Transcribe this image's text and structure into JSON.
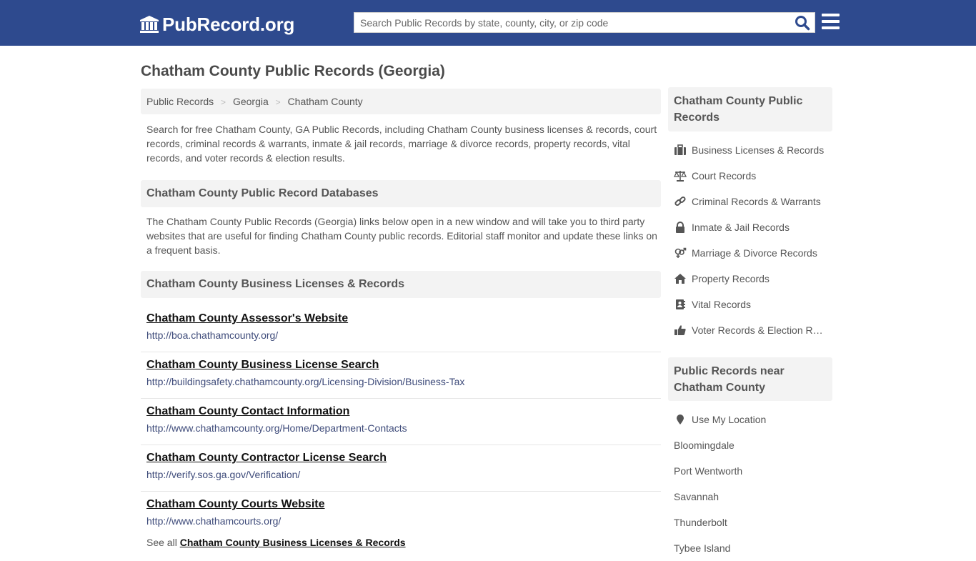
{
  "header": {
    "logo_text": "PubRecord.org",
    "search_placeholder": "Search Public Records by state, county, city, or zip code",
    "search_value": ""
  },
  "page": {
    "title": "Chatham County Public Records (Georgia)",
    "breadcrumb": [
      "Public Records",
      "Georgia",
      "Chatham County"
    ],
    "intro": "Search for free Chatham County, GA Public Records, including Chatham County business licenses & records, court records, criminal records & warrants, inmate & jail records, marriage & divorce records, property records, vital records, and voter records & election results."
  },
  "databases": {
    "heading": "Chatham County Public Record Databases",
    "description": "The Chatham County Public Records (Georgia) links below open in a new window and will take you to third party websites that are useful for finding Chatham County public records. Editorial staff monitor and update these links on a frequent basis."
  },
  "business": {
    "heading": "Chatham County Business Licenses & Records",
    "links": [
      {
        "title": "Chatham County Assessor's Website",
        "url": "http://boa.chathamcounty.org/"
      },
      {
        "title": "Chatham County Business License Search",
        "url": "http://buildingsafety.chathamcounty.org/Licensing-Division/Business-Tax"
      },
      {
        "title": "Chatham County Contact Information",
        "url": "http://www.chathamcounty.org/Home/Department-Contacts"
      },
      {
        "title": "Chatham County Contractor License Search",
        "url": "http://verify.sos.ga.gov/Verification/"
      },
      {
        "title": "Chatham County Courts Website",
        "url": "http://www.chathamcourts.org/"
      }
    ],
    "see_all_prefix": "See all",
    "see_all_link": "Chatham County Business Licenses & Records"
  },
  "sidebar": {
    "records_heading": "Chatham County Public Records",
    "records": [
      {
        "label": "Business Licenses & Records",
        "icon": "briefcase-icon"
      },
      {
        "label": "Court Records",
        "icon": "scale-icon"
      },
      {
        "label": "Criminal Records & Warrants",
        "icon": "link-icon"
      },
      {
        "label": "Inmate & Jail Records",
        "icon": "lock-icon"
      },
      {
        "label": "Marriage & Divorce Records",
        "icon": "gender-icon"
      },
      {
        "label": "Property Records",
        "icon": "home-icon"
      },
      {
        "label": "Vital Records",
        "icon": "address-book-icon"
      },
      {
        "label": "Voter Records & Election Results",
        "icon": "thumbs-up-icon"
      }
    ],
    "nearby_heading": "Public Records near Chatham County",
    "use_location": "Use My Location",
    "nearby": [
      "Bloomingdale",
      "Port Wentworth",
      "Savannah",
      "Thunderbolt",
      "Tybee Island"
    ]
  }
}
